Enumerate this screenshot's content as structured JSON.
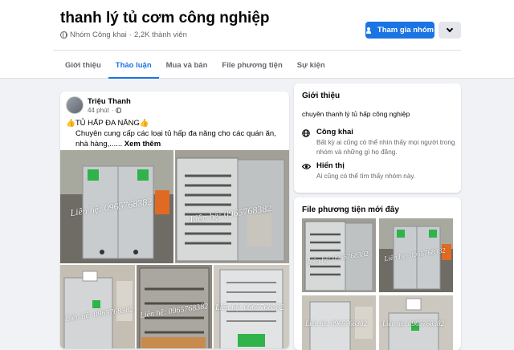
{
  "group": {
    "title": "thanh lý tủ cơm công nghiệp",
    "privacy": "Nhóm Công khai",
    "separator": "·",
    "members": "2,2K thành viên",
    "join_label": "Tham gia nhóm"
  },
  "tabs": [
    "Giới thiệu",
    "Thảo luận",
    "Mua và bán",
    "File phương tiện",
    "Sự kiện"
  ],
  "active_tab": "Thảo luận",
  "post": {
    "author": "Triệu Thanh",
    "time": "44 phút",
    "line1": "👍TỦ HẤP ĐA NĂNG👍",
    "line2": "Chuyên cung cấp các loại tủ hấp đa năng cho các quán ăn, nhà hàng,......",
    "see_more": "Xem thêm",
    "watermarks": [
      "Liên hệ: 0965768382",
      "Liên hệ: 0965768382",
      "Liên hệ: 0965768382",
      "Liên hệ: 0965768382",
      "Liên hệ: 0965768382"
    ]
  },
  "about": {
    "title": "Giới thiệu",
    "description": "chuyên thanh lý tủ hấp công nghiệp",
    "public_title": "Công khai",
    "public_text": "Bất kỳ ai cũng có thể nhìn thấy mọi người trong nhóm và những gì họ đăng.",
    "visible_title": "Hiển thị",
    "visible_text": "Ai cũng có thể tìm thấy nhóm này."
  },
  "media": {
    "title": "File phương tiện mới đây",
    "watermarks": [
      "Liên hệ: 0965768382",
      "Liên hệ: 0965768382",
      "Liên hệ: 0965768382",
      "Liên hệ: 0965768382"
    ]
  },
  "colors": {
    "accent": "#1b74e4",
    "background": "#f0f2f5",
    "steel": "#b8bcc0",
    "green_sticker": "#2fb34a"
  }
}
